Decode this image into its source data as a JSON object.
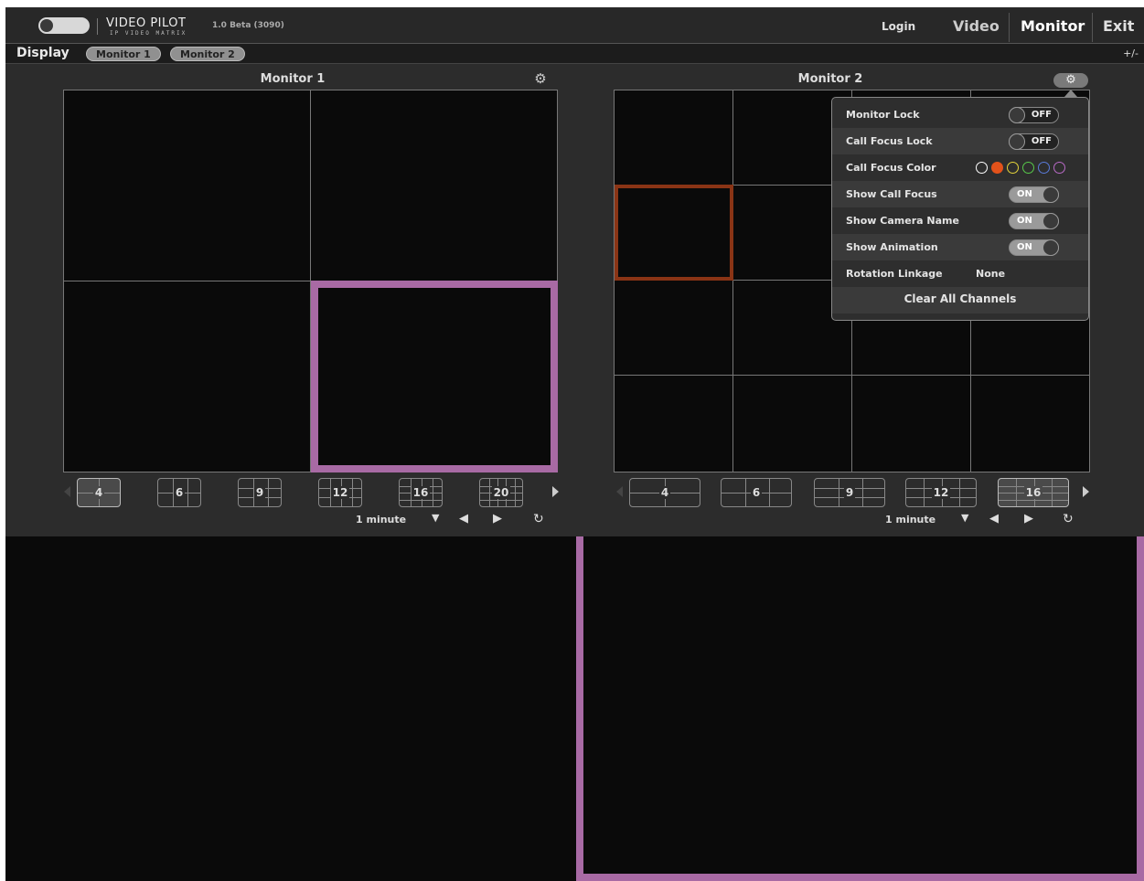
{
  "app": {
    "title": "VIDEO PILOT",
    "subtitle": "IP VIDEO MATRIX",
    "version": "1.0 Beta (3090)"
  },
  "nav": {
    "login": "Login",
    "video": "Video",
    "monitor": "Monitor",
    "exit": "Exit"
  },
  "display_bar": {
    "label": "Display",
    "tabs": [
      "Monitor 1",
      "Monitor 2"
    ],
    "toggle": "+/-"
  },
  "monitors": [
    {
      "title": "Monitor 1",
      "layouts": [
        "4",
        "6",
        "9",
        "12",
        "16",
        "20"
      ],
      "active_layout": "4",
      "rotation": "1 minute"
    },
    {
      "title": "Monitor 2",
      "layouts": [
        "4",
        "6",
        "9",
        "12",
        "16"
      ],
      "active_layout": "16",
      "rotation": "1 minute"
    }
  ],
  "settings_popup": {
    "monitor_lock": {
      "label": "Monitor Lock",
      "state": "OFF"
    },
    "call_focus_lock": {
      "label": "Call Focus Lock",
      "state": "OFF"
    },
    "call_focus_color": {
      "label": "Call Focus Color",
      "colors": [
        "#ffffff",
        "#e2521b",
        "#e4d43a",
        "#58c94a",
        "#5a7ad8",
        "#b86ac6"
      ],
      "selected": "#e2521b"
    },
    "show_call_focus": {
      "label": "Show Call Focus",
      "state": "ON"
    },
    "show_camera_name": {
      "label": "Show Camera Name",
      "state": "ON"
    },
    "show_animation": {
      "label": "Show Animation",
      "state": "ON"
    },
    "rotation_linkage": {
      "label": "Rotation Linkage",
      "value": "None"
    },
    "clear_all": "Clear All Channels"
  },
  "colors": {
    "selection": "#a86aa4",
    "call_focus": "#8a3415"
  }
}
